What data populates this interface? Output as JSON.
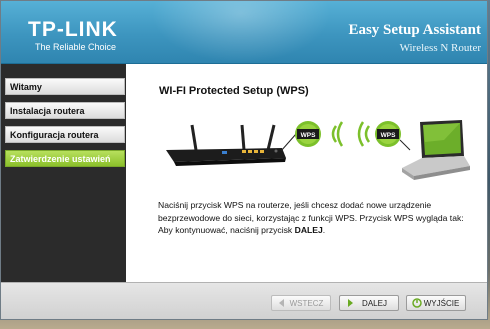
{
  "header": {
    "logo": "TP-LINK",
    "tagline": "The Reliable Choice",
    "title": "Easy Setup Assistant",
    "subtitle": "Wireless N Router"
  },
  "sidebar": {
    "items": [
      {
        "label": "Witamy",
        "active": false
      },
      {
        "label": "Instalacja routera",
        "active": false
      },
      {
        "label": "Konfiguracja routera",
        "active": false
      },
      {
        "label": "Zatwierdzenie ustawień",
        "active": true
      }
    ]
  },
  "main": {
    "title": "WI-FI Protected Setup (WPS)",
    "wps_badge_left": "WPS",
    "wps_badge_right": "WPS",
    "paragraph1": "Naciśnij przycisk WPS na routerze, jeśli chcesz dodać nowe urządzenie bezprzewodowe do sieci, korzystając z funkcji WPS. Przycisk WPS wygląda tak:",
    "paragraph2_prefix": "Aby kontynuować, naciśnij przycisk ",
    "paragraph2_strong": "DALEJ",
    "paragraph2_suffix": "."
  },
  "footer": {
    "back_label": "WSTECZ",
    "next_label": "DALEJ",
    "exit_label": "WYJŚCIE"
  },
  "colors": {
    "header": "#3d95bf",
    "active_nav": "#8cc02b",
    "wps_green": "#7cc02b"
  }
}
